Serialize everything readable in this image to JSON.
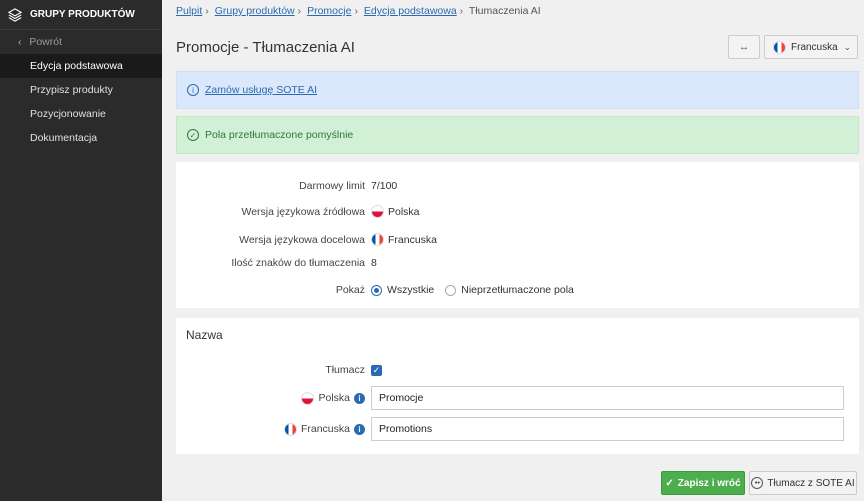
{
  "sidebar": {
    "header": "GRUPY PRODUKTÓW",
    "back": "Powrót",
    "items": [
      {
        "label": "Edycja podstawowa"
      },
      {
        "label": "Przypisz produkty"
      },
      {
        "label": "Pozycjonowanie"
      },
      {
        "label": "Dokumentacja"
      }
    ]
  },
  "breadcrumb": {
    "items": [
      "Pulpit",
      "Grupy produktów",
      "Promocje",
      "Edycja podstawowa"
    ],
    "current": "Tłumaczenia AI",
    "separator": "›"
  },
  "page": {
    "title": "Promocje - Tłumaczenia AI"
  },
  "toolbar": {
    "expand_glyph": "↔",
    "language": "Francuska"
  },
  "alerts": {
    "info_link": "Zamów usługę SOTE AI",
    "success": "Pola przetłumaczone pomyślnie"
  },
  "info": {
    "free_limit_label": "Darmowy limit",
    "free_limit_value": "7/100",
    "source_label": "Wersja językowa źródłowa",
    "source_value": "Polska",
    "target_label": "Wersja językowa docelowa",
    "target_value": "Francuska",
    "chars_label": "Ilość znaków do tłumaczenia",
    "chars_value": "8",
    "show_label": "Pokaż",
    "show_options": [
      "Wszystkie",
      "Nieprzetłumaczone pola"
    ],
    "show_selected": "Wszystkie"
  },
  "name_section": {
    "heading": "Nazwa",
    "translator_label": "Tłumacz",
    "translator_checked": true,
    "polish_label": "Polska",
    "polish_value": "Promocje",
    "french_label": "Francuska",
    "french_value": "Promotions"
  },
  "actions": {
    "save": "Zapisz i wróć",
    "translate": "Tłumacz z SOTE AI"
  },
  "colors": {
    "accent": "#2a6ab3",
    "success": "#4cae4c",
    "sidebar": "#2b2b2b"
  }
}
